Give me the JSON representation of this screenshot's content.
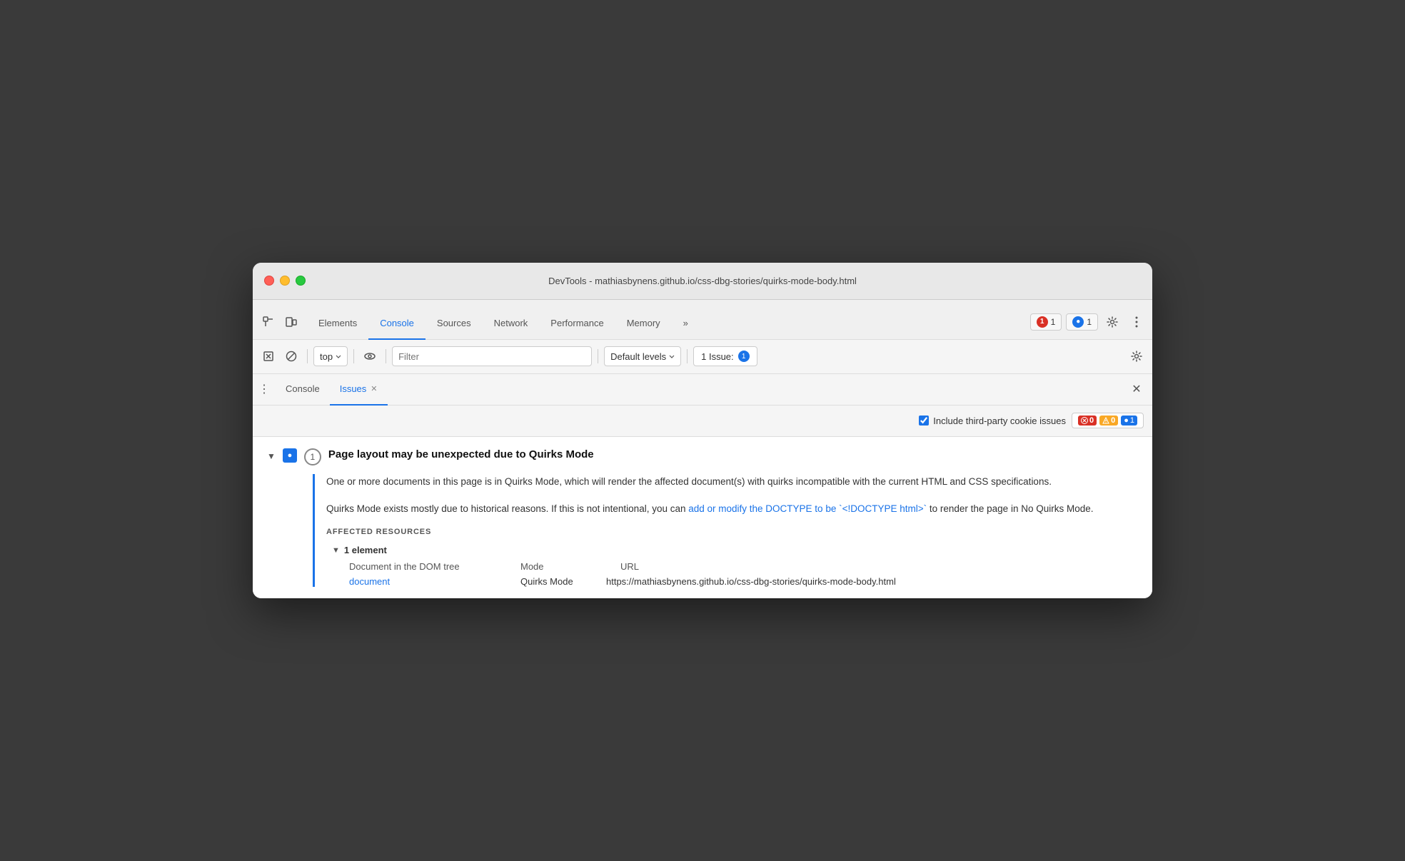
{
  "window": {
    "title": "DevTools - mathiasbynens.github.io/css-dbg-stories/quirks-mode-body.html"
  },
  "tabs": {
    "items": [
      {
        "id": "elements",
        "label": "Elements",
        "active": false
      },
      {
        "id": "console",
        "label": "Console",
        "active": true
      },
      {
        "id": "sources",
        "label": "Sources",
        "active": false
      },
      {
        "id": "network",
        "label": "Network",
        "active": false
      },
      {
        "id": "performance",
        "label": "Performance",
        "active": false
      },
      {
        "id": "memory",
        "label": "Memory",
        "active": false
      }
    ],
    "more_label": "»"
  },
  "toolbar": {
    "context_selector": "top",
    "filter_placeholder": "Filter",
    "levels_label": "Default levels",
    "issues_badge_label": "1 Issue:",
    "issues_badge_count": "1"
  },
  "secondary_tabs": {
    "items": [
      {
        "id": "console",
        "label": "Console",
        "closeable": false,
        "active": false
      },
      {
        "id": "issues",
        "label": "Issues",
        "closeable": true,
        "active": true
      }
    ]
  },
  "issues_filter": {
    "include_third_party_label": "Include third-party cookie issues",
    "error_count": "0",
    "warning_count": "0",
    "info_count": "1"
  },
  "issue": {
    "title": "Page layout may be unexpected due to Quirks Mode",
    "count": "1",
    "description_part1": "One or more documents in this page is in Quirks Mode, which will render the affected document(s) with quirks incompatible with the current HTML and CSS specifications.",
    "description_part2_prefix": "Quirks Mode exists mostly due to historical reasons. If this is not intentional, you can ",
    "description_link_text": "add or modify the DOCTYPE to be `<!DOCTYPE html>`",
    "description_part2_suffix": " to render the page in No Quirks Mode.",
    "affected_resources_label": "AFFECTED RESOURCES",
    "resource_count_label": "1 element",
    "col_doc": "Document in the DOM tree",
    "col_mode_header": "Mode",
    "col_url_header": "URL",
    "resource_link": "document",
    "resource_mode": "Quirks Mode",
    "resource_url": "https://mathiasbynens.github.io/css-dbg-stories/quirks-mode-body.html"
  },
  "badge_counts": {
    "error": "1",
    "info": "1"
  },
  "colors": {
    "blue": "#1a73e8",
    "error_red": "#d93025",
    "warning_yellow": "#f9a825"
  }
}
